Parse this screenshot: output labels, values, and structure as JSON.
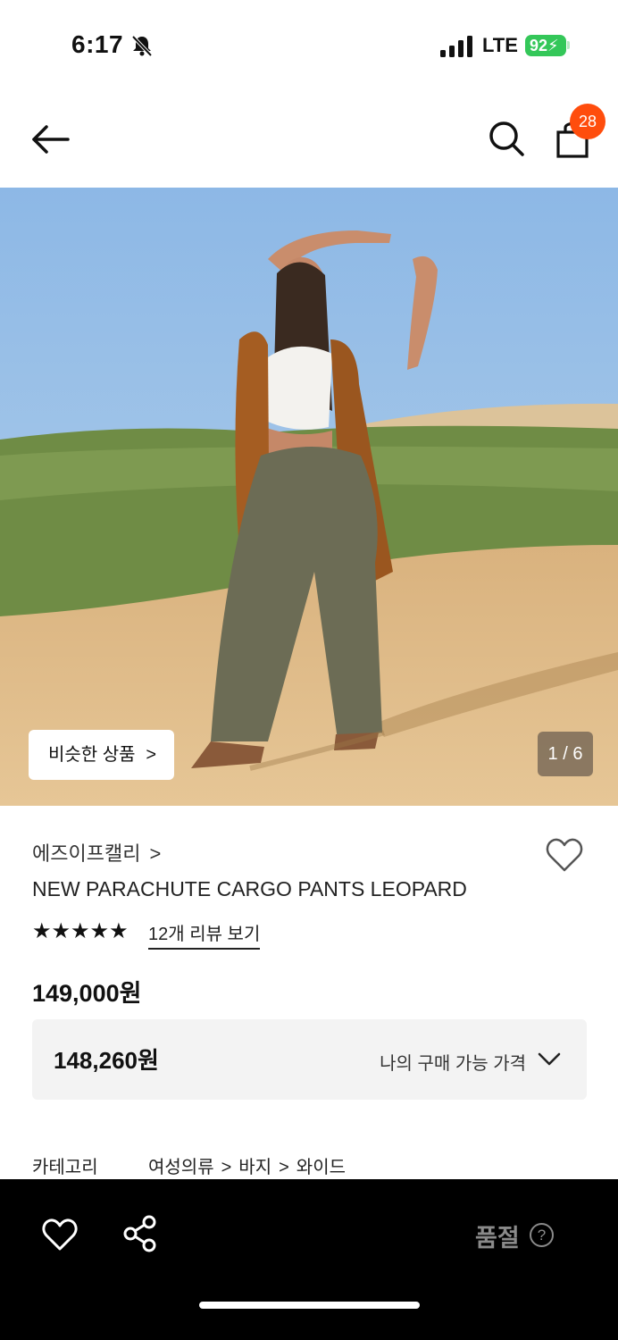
{
  "status_bar": {
    "time": "6:17",
    "network": "LTE",
    "battery": "92"
  },
  "header": {
    "cart_count": "28"
  },
  "hero": {
    "similar_label": "비슷한 상품",
    "similar_chevron": ">",
    "page_indicator": "1 / 6"
  },
  "product": {
    "brand": "에즈이프캘리",
    "brand_chevron": ">",
    "title": "NEW PARACHUTE CARGO PANTS LEOPARD",
    "stars": "★★★★★",
    "rating_value": 5,
    "review_link": "12개 리뷰 보기",
    "price": "149,000원",
    "my_price": "148,260원",
    "my_price_label": "나의 구매 가능 가격"
  },
  "category": {
    "label": "카테고리",
    "path": [
      "여성의류",
      "바지",
      "와이드"
    ],
    "separator": ">"
  },
  "bottom_bar": {
    "soldout_label": "품절",
    "help_label": "?"
  },
  "colors": {
    "badge": "#ff4d0d",
    "battery": "#34c759",
    "bottom_bar": "#000000"
  },
  "icons": [
    "bell-slash-icon",
    "signal-icon",
    "back-arrow-icon",
    "search-icon",
    "shopping-bag-icon",
    "heart-icon",
    "chevron-down-icon",
    "share-icon",
    "help-icon"
  ]
}
